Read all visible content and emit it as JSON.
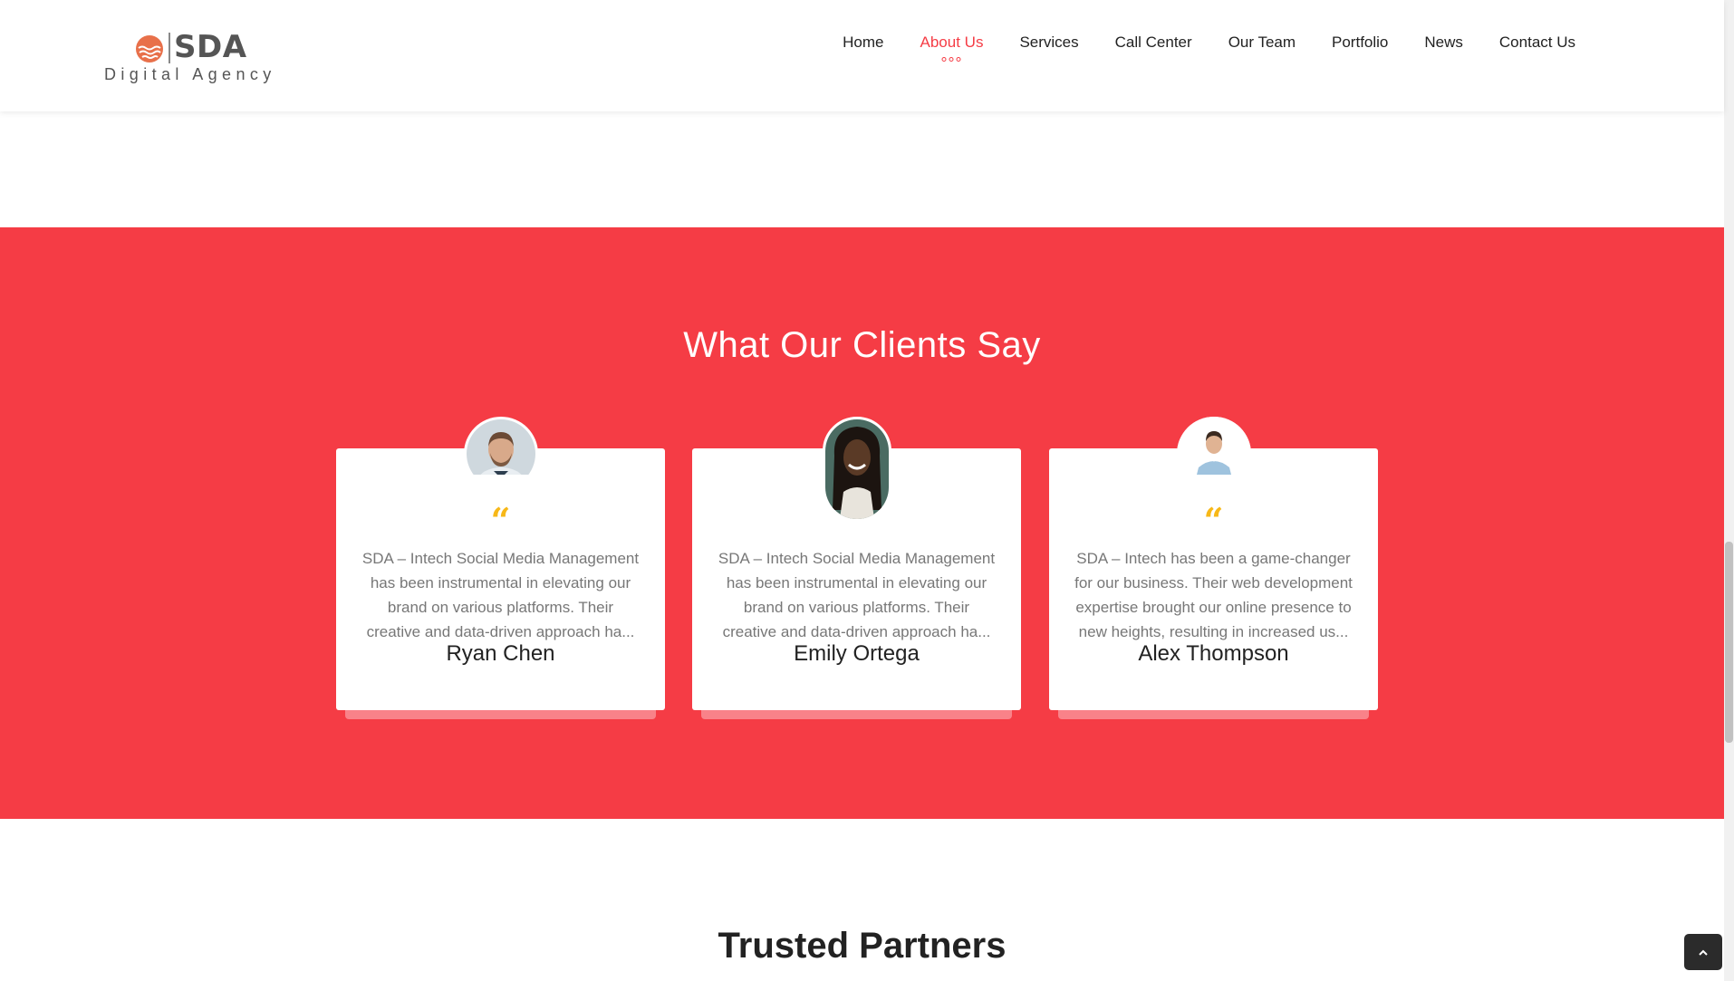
{
  "brand": {
    "name": "SDA",
    "tagline": "Digital Agency",
    "logo_color": "#e8704a"
  },
  "nav": {
    "items": [
      {
        "label": "Home",
        "active": false
      },
      {
        "label": "About Us",
        "active": true
      },
      {
        "label": "Services",
        "active": false
      },
      {
        "label": "Call Center",
        "active": false
      },
      {
        "label": "Our Team",
        "active": false
      },
      {
        "label": "Portfolio",
        "active": false
      },
      {
        "label": "News",
        "active": false
      },
      {
        "label": "Contact Us",
        "active": false
      }
    ],
    "active_color": "#f53c45"
  },
  "testimonials": {
    "title": "What Our Clients Say",
    "background": "#f53c45",
    "quote_color": "#f7b818",
    "cards": [
      {
        "name": "Ryan Chen",
        "text": "SDA – Intech Social Media Management has been instrumental in elevating our brand on various platforms. Their creative and data-driven approach ha...",
        "avatar": "man-beard-avatar"
      },
      {
        "name": "Emily Ortega",
        "text": "SDA – Intech Social Media Management has been instrumental in elevating our brand on various platforms. Their creative and data-driven approach ha...",
        "avatar": "woman-braids-avatar"
      },
      {
        "name": "Alex Thompson",
        "text": "SDA – Intech has been a game-changer for our business. Their web development expertise brought our online presence to new heights, resulting in increased us...",
        "avatar": "man-shirt-avatar"
      }
    ]
  },
  "partners": {
    "title": "Trusted Partners"
  },
  "controls": {
    "scroll_top_icon": "chevron-up-icon"
  }
}
